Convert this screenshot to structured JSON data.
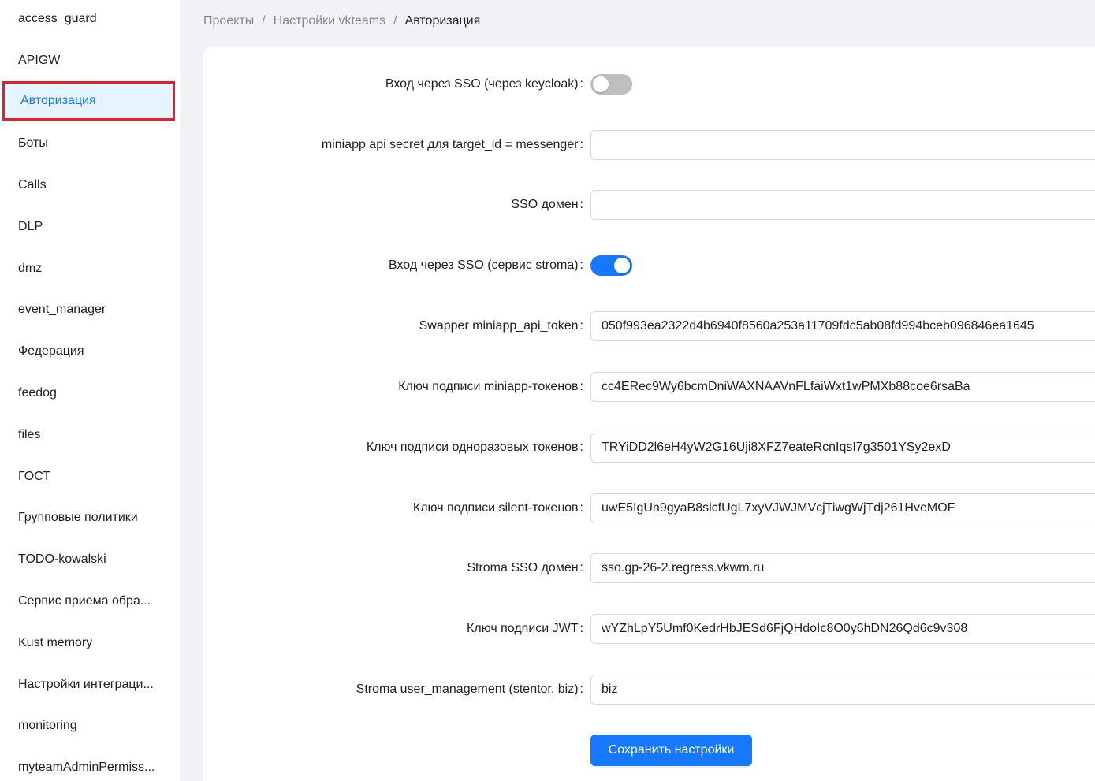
{
  "sidebar": {
    "items": [
      {
        "label": "access_guard"
      },
      {
        "label": "APIGW"
      },
      {
        "label": "Авторизация"
      },
      {
        "label": "Боты"
      },
      {
        "label": "Calls"
      },
      {
        "label": "DLP"
      },
      {
        "label": "dmz"
      },
      {
        "label": "event_manager"
      },
      {
        "label": "Федерация"
      },
      {
        "label": "feedog"
      },
      {
        "label": "files"
      },
      {
        "label": "ГОСТ"
      },
      {
        "label": "Групповые политики"
      },
      {
        "label": "TODO-kowalski"
      },
      {
        "label": "Сервис приема обра..."
      },
      {
        "label": "Kust memory"
      },
      {
        "label": "Настройки интеграци..."
      },
      {
        "label": "monitoring"
      },
      {
        "label": "myteamAdminPermiss..."
      }
    ]
  },
  "breadcrumb": {
    "items": [
      "Проекты",
      "Настройки vkteams",
      "Авторизация"
    ],
    "separator": "/"
  },
  "form": {
    "colon": ":",
    "fields": [
      {
        "label": "Вход через SSO (через keycloak)",
        "type": "switch",
        "checked": false
      },
      {
        "label": "miniapp api secret для target_id = messenger",
        "type": "input",
        "value": ""
      },
      {
        "label": "SSO домен",
        "type": "input",
        "value": ""
      },
      {
        "label": "Вход через SSO (сервис stroma)",
        "type": "switch",
        "checked": true
      },
      {
        "label": "Swapper miniapp_api_token",
        "type": "input",
        "value": "050f993ea2322d4b6940f8560a253a11709fdc5ab08fd994bceb096846ea1645"
      },
      {
        "label": "Ключ подписи miniapp-токенов",
        "type": "input",
        "value": "cc4ERec9Wy6bcmDniWAXNAAVnFLfaiWxt1wPMXb88coe6rsaBa"
      },
      {
        "label": "Ключ подписи одноразовых токенов",
        "type": "input",
        "value": "TRYiDD2l6eH4yW2G16Uji8XFZ7eateRcnIqsI7g3501YSy2exD"
      },
      {
        "label": "Ключ подписи silent-токенов",
        "type": "input",
        "value": "uwE5IgUn9gyaB8slcfUgL7xyVJWJMVcjTiwgWjTdj261HveMOF"
      },
      {
        "label": "Stroma SSO домен",
        "type": "input",
        "value": "sso.gp-26-2.regress.vkwm.ru"
      },
      {
        "label": "Ключ подписи JWT",
        "type": "input",
        "value": "wYZhLpY5Umf0KedrHbJESd6FjQHdoIc8O0y6hDN26Qd6c9v308"
      },
      {
        "label": "Stroma user_management (stentor, biz)",
        "type": "input",
        "value": "biz"
      }
    ],
    "save_label": "Сохранить настройки"
  },
  "colors": {
    "accent": "#1677ff",
    "active_bg": "#e6f4ff",
    "highlight_border": "#e0202a",
    "page_bg": "#f0f2f5"
  }
}
